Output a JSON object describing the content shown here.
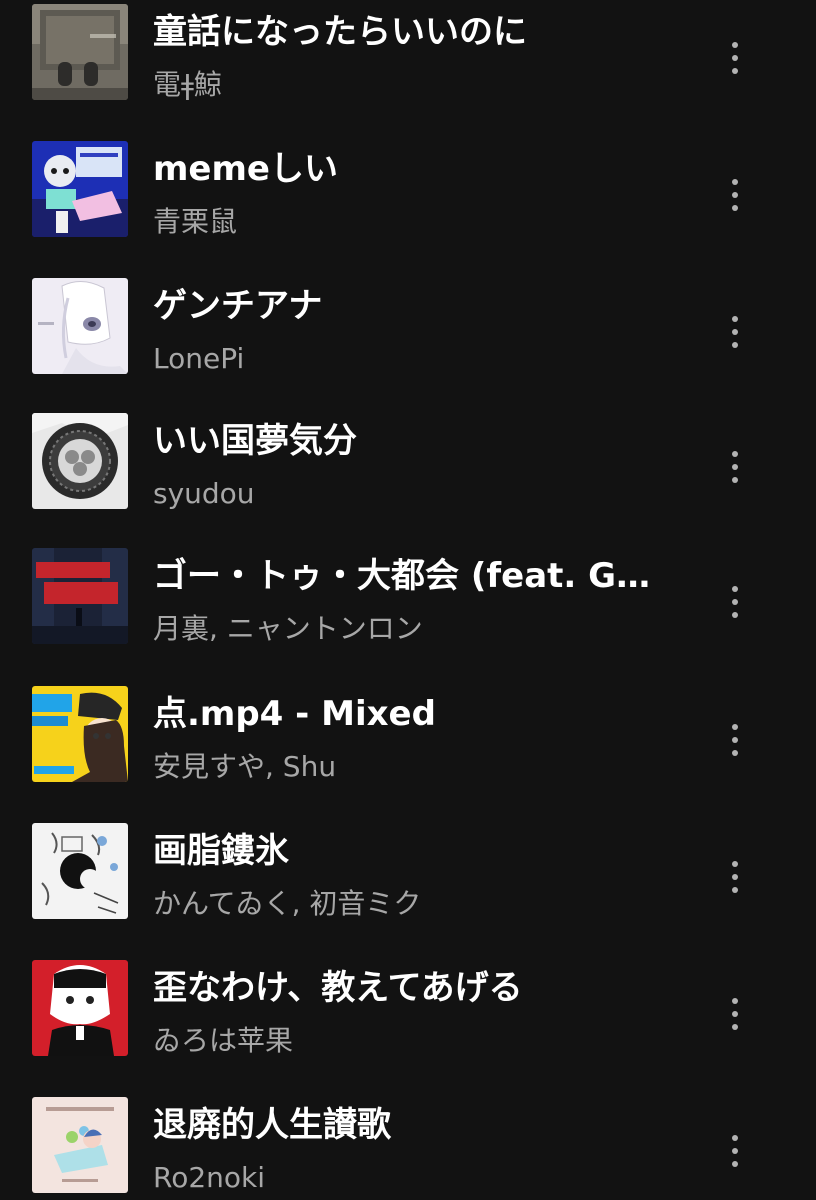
{
  "tracks": [
    {
      "title": "童話になったらいいのに",
      "artist": "電ǂ鯨"
    },
    {
      "title": "memeしい",
      "artist": "青栗鼠"
    },
    {
      "title": "ゲンチアナ",
      "artist": "LonePi"
    },
    {
      "title": "いい国夢気分",
      "artist": "syudou"
    },
    {
      "title": "ゴー・トゥ・大都会 (feat. GU...",
      "artist": "月裏, ニャントンロン"
    },
    {
      "title": "点.mp4 - Mixed",
      "artist": "安見すや, Shu"
    },
    {
      "title": "画脂鏤氷",
      "artist": "かんてゐく, 初音ミク"
    },
    {
      "title": "歪なわけ、教えてあげる",
      "artist": "ゐろは苹果"
    },
    {
      "title": "退廃的人生讃歌",
      "artist": "Ro2noki"
    }
  ],
  "icons": {
    "more": "more-vertical-icon"
  },
  "colors": {
    "background": "#121212",
    "title": "#ffffff",
    "subtitle": "#a7a7a7",
    "more_icon": "#b3b3b3"
  }
}
